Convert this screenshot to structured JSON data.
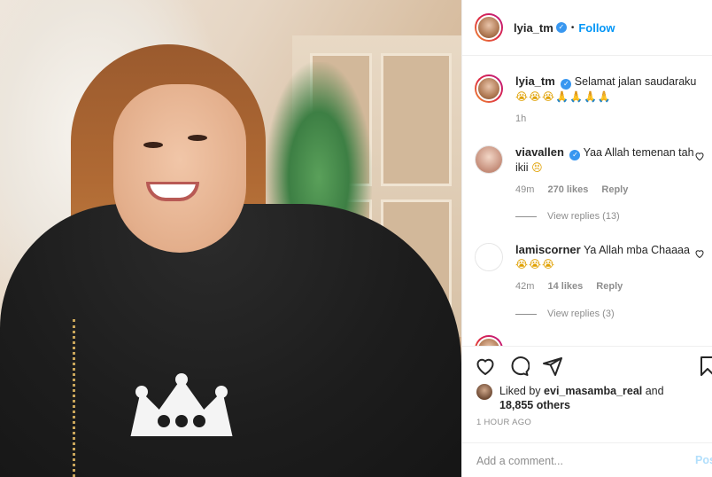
{
  "post": {
    "username": "lyia_tm",
    "follow_label": "Follow",
    "dot": "•",
    "caption": "Selamat jalan saudaraku",
    "caption_emoji": "😭😭😭🙏🙏🙏🙏",
    "caption_time": "1h"
  },
  "comments": [
    {
      "username": "viavallen",
      "text": "Yaa Allah temenan tah ikii",
      "emoji": "😣",
      "time": "49m",
      "likes": "270 likes",
      "reply_label": "Reply",
      "view_replies": "View replies (13)"
    },
    {
      "username": "lamiscorner",
      "text": "Ya Allah mba Chaaaa",
      "emoji": "😭😭😭",
      "time": "42m",
      "likes": "14 likes",
      "reply_label": "Reply",
      "view_replies": "View replies (3)"
    }
  ],
  "likes": {
    "prefix": "Liked by",
    "liker": "evi_masamba_real",
    "and": "and",
    "others": "18,855 others"
  },
  "timestamp": "1 HOUR AGO",
  "add_comment": {
    "placeholder": "Add a comment...",
    "post_label": "Post"
  },
  "icons": {
    "like": "heart-icon",
    "comment": "comment-icon",
    "share": "share-icon",
    "save": "bookmark-icon",
    "verified": "verified-badge-icon",
    "comment_like": "heart-small-icon"
  },
  "colors": {
    "link": "#0095f6",
    "verified": "#3897f0",
    "muted": "#8e8e8e",
    "post_disabled": "#b2dffc"
  }
}
